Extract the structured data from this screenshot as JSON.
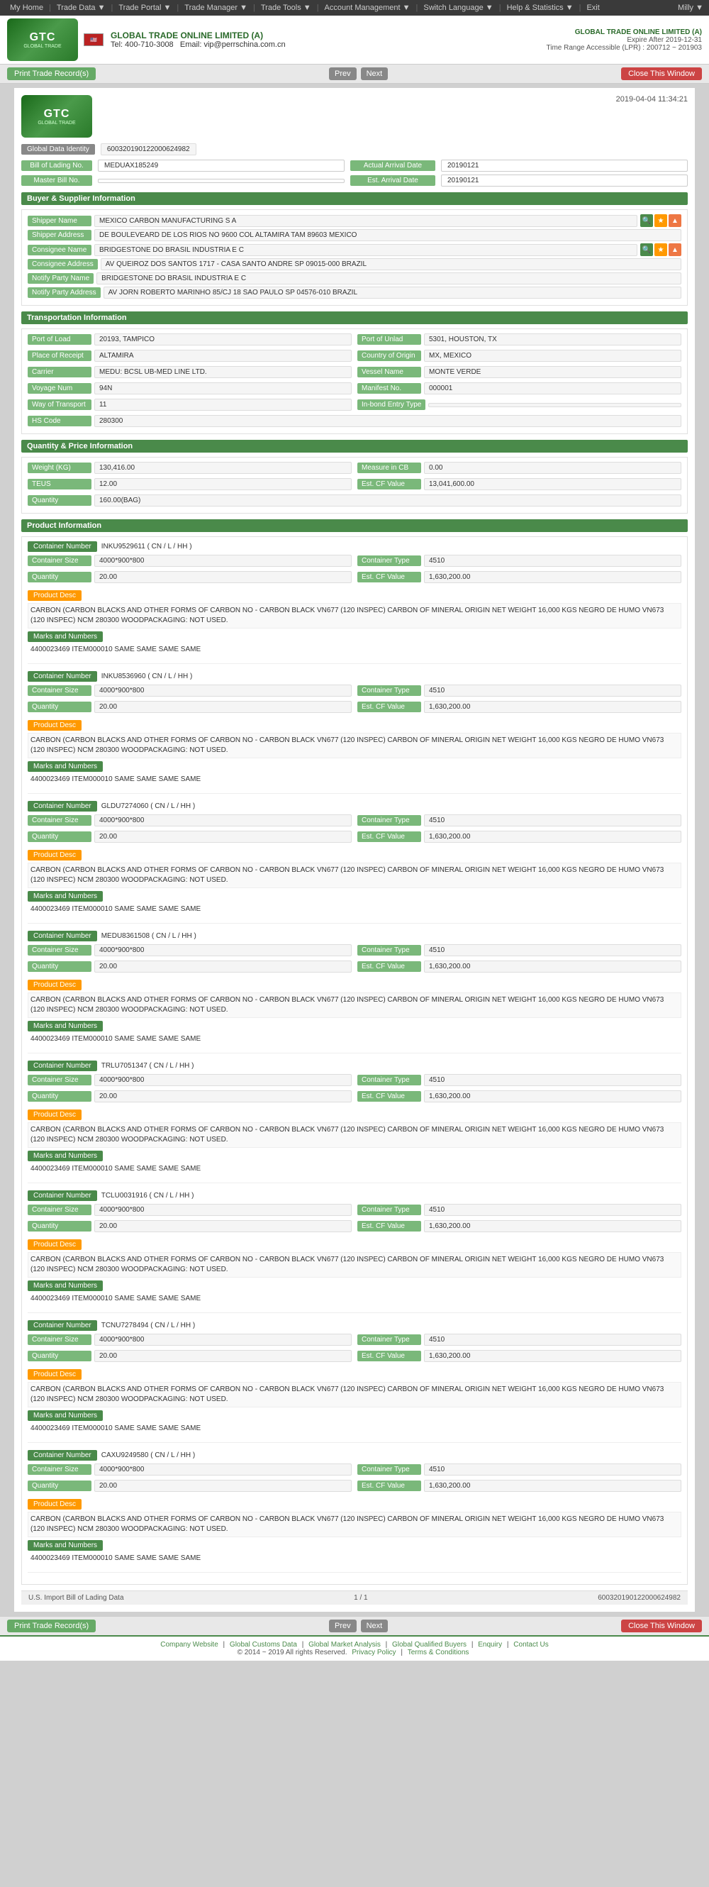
{
  "nav": {
    "items": [
      {
        "label": "My Home",
        "id": "my-home"
      },
      {
        "label": "Trade Data ▼",
        "id": "trade-data"
      },
      {
        "label": "Trade Portal ▼",
        "id": "trade-portal"
      },
      {
        "label": "Trade Manager ▼",
        "id": "trade-manager"
      },
      {
        "label": "Trade Tools ▼",
        "id": "trade-tools"
      },
      {
        "label": "Account Management ▼",
        "id": "account-management"
      },
      {
        "label": "Switch Language ▼",
        "id": "switch-language"
      },
      {
        "label": "Help & Statistics ▼",
        "id": "help-statistics"
      },
      {
        "label": "Exit",
        "id": "exit"
      }
    ],
    "user": "Milly ▼"
  },
  "header": {
    "company_name": "GLOBAL TRADE ONLINE LIMITED (A)",
    "phone": "Tel: 400-710-3008",
    "email": "Email: vip@perrschina.com.cn",
    "gtol_title": "GLOBAL TRADE ONLINE LIMITED (A)",
    "expire": "Expire After 2019-12-31",
    "time_range": "Time Range Accessible (LPR) : 200712 ~ 201903",
    "logo_text": "GTC"
  },
  "toolbar": {
    "print_label": "Print Trade Record(s)",
    "prev_label": "Prev",
    "next_label": "Next",
    "close_label": "Close This Window"
  },
  "document": {
    "title": "U.S. Import Bill of Lading Data",
    "date": "2019-04-04 11:34:21",
    "global_data_identity_label": "Global Data Identity",
    "global_data_identity_value": "600320190122000624982",
    "bill_of_lading_no_label": "Bill of Lading No.",
    "bill_of_lading_no_value": "MEDUAX185249",
    "master_bill_label": "Master Bill No.",
    "actual_arrival_date_label": "Actual Arrival Date",
    "actual_arrival_date_value": "20190121",
    "est_arrival_date_label": "Est. Arrival Date",
    "est_arrival_date_value": "20190121"
  },
  "buyer_supplier": {
    "section_title": "Buyer & Supplier Information",
    "shipper_name_label": "Shipper Name",
    "shipper_name_value": "MEXICO CARBON MANUFACTURING S A",
    "shipper_address_label": "Shipper Address",
    "shipper_address_value": "DE BOULEVEARD DE LOS RIOS NO 9600 COL ALTAMIRA TAM 89603 MEXICO",
    "consignee_name_label": "Consignee Name",
    "consignee_name_value": "BRIDGESTONE DO BRASIL INDUSTRIA E C",
    "consignee_address_label": "Consignee Address",
    "consignee_address_value": "AV QUEIROZ DOS SANTOS 1717 - CASA SANTO ANDRE SP 09015-000 BRAZIL",
    "notify_party_name_label": "Notify Party Name",
    "notify_party_name_value": "BRIDGESTONE DO BRASIL INDUSTRIA E C",
    "notify_party_address_label": "Notify Party Address",
    "notify_party_address_value": "AV JORN ROBERTO MARINHO 85/CJ 18 SAO PAULO SP 04576-010 BRAZIL"
  },
  "transportation": {
    "section_title": "Transportation Information",
    "port_of_load_label": "Port of Load",
    "port_of_load_value": "20193, TAMPICO",
    "port_of_unlad_label": "Port of Unlad",
    "port_of_unlad_value": "5301, HOUSTON, TX",
    "place_of_receipt_label": "Place of Receipt",
    "place_of_receipt_value": "ALTAMIRA",
    "country_of_origin_label": "Country of Origin",
    "country_of_origin_value": "MX, MEXICO",
    "carrier_label": "Carrier",
    "carrier_value": "MEDU: BCSL UB-MED LINE LTD.",
    "vessel_name_label": "Vessel Name",
    "vessel_name_value": "MONTE VERDE",
    "voyage_num_label": "Voyage Num",
    "voyage_num_value": "94N",
    "manifest_no_label": "Manifest No.",
    "manifest_no_value": "000001",
    "way_of_transport_label": "Way of Transport",
    "way_of_transport_value": "11",
    "in_bond_entry_type_label": "In-bond Entry Type",
    "in_bond_entry_type_value": "",
    "hs_code_label": "HS Code",
    "hs_code_value": "280300"
  },
  "quantity_price": {
    "section_title": "Quantity & Price Information",
    "weight_label": "Weight (KG)",
    "weight_value": "130,416.00",
    "measure_in_cb_label": "Measure in CB",
    "measure_in_cb_value": "0.00",
    "teus_label": "TEUS",
    "teus_value": "12.00",
    "est_cf_value_label": "Est. CF Value",
    "est_cf_value_value": "13,041,600.00",
    "quantity_label": "Quantity",
    "quantity_value": "160.00(BAG)"
  },
  "product_info": {
    "section_title": "Product Information",
    "containers": [
      {
        "id": "c1",
        "number_label": "Container Number",
        "number_value": "INKU9529611 ( CN / L / HH )",
        "size_label": "Container Size",
        "size_value": "4000*900*800",
        "type_label": "Container Type",
        "type_value": "4510",
        "quantity_label": "Quantity",
        "quantity_value": "20.00",
        "est_cf_label": "Est. CF Value",
        "est_cf_value": "1,630,200.00",
        "product_desc_label": "Product Desc",
        "product_desc": "CARBON (CARBON BLACKS AND OTHER FORMS OF CARBON NO - CARBON BLACK VN677 (120 INSPEC) CARBON OF MINERAL ORIGIN NET WEIGHT 16,000 KGS NEGRO DE HUMO VN673 (120 INSPEC) NCM 280300 WOODPACKAGING: NOT USED.",
        "marks_label": "Marks and Numbers",
        "marks_value": "4400023469 ITEM000010 SAME SAME SAME SAME"
      },
      {
        "id": "c2",
        "number_label": "Container Number",
        "number_value": "INKU8536960 ( CN / L / HH )",
        "size_label": "Container Size",
        "size_value": "4000*900*800",
        "type_label": "Container Type",
        "type_value": "4510",
        "quantity_label": "Quantity",
        "quantity_value": "20.00",
        "est_cf_label": "Est. CF Value",
        "est_cf_value": "1,630,200.00",
        "product_desc_label": "Product Desc",
        "product_desc": "CARBON (CARBON BLACKS AND OTHER FORMS OF CARBON NO - CARBON BLACK VN677 (120 INSPEC) CARBON OF MINERAL ORIGIN NET WEIGHT 16,000 KGS NEGRO DE HUMO VN673 (120 INSPEC) NCM 280300 WOODPACKAGING: NOT USED.",
        "marks_label": "Marks and Numbers",
        "marks_value": "4400023469 ITEM000010 SAME SAME SAME SAME"
      },
      {
        "id": "c3",
        "number_label": "Container Number",
        "number_value": "GLDU7274060 ( CN / L / HH )",
        "size_label": "Container Size",
        "size_value": "4000*900*800",
        "type_label": "Container Type",
        "type_value": "4510",
        "quantity_label": "Quantity",
        "quantity_value": "20.00",
        "est_cf_label": "Est. CF Value",
        "est_cf_value": "1,630,200.00",
        "product_desc_label": "Product Desc",
        "product_desc": "CARBON (CARBON BLACKS AND OTHER FORMS OF CARBON NO - CARBON BLACK VN677 (120 INSPEC) CARBON OF MINERAL ORIGIN NET WEIGHT 16,000 KGS NEGRO DE HUMO VN673 (120 INSPEC) NCM 280300 WOODPACKAGING: NOT USED.",
        "marks_label": "Marks and Numbers",
        "marks_value": "4400023469 ITEM000010 SAME SAME SAME SAME"
      },
      {
        "id": "c4",
        "number_label": "Container Number",
        "number_value": "MEDU8361508 ( CN / L / HH )",
        "size_label": "Container Size",
        "size_value": "4000*900*800",
        "type_label": "Container Type",
        "type_value": "4510",
        "quantity_label": "Quantity",
        "quantity_value": "20.00",
        "est_cf_label": "Est. CF Value",
        "est_cf_value": "1,630,200.00",
        "product_desc_label": "Product Desc",
        "product_desc": "CARBON (CARBON BLACKS AND OTHER FORMS OF CARBON NO - CARBON BLACK VN677 (120 INSPEC) CARBON OF MINERAL ORIGIN NET WEIGHT 16,000 KGS NEGRO DE HUMO VN673 (120 INSPEC) NCM 280300 WOODPACKAGING: NOT USED.",
        "marks_label": "Marks and Numbers",
        "marks_value": "4400023469 ITEM000010 SAME SAME SAME SAME"
      },
      {
        "id": "c5",
        "number_label": "Container Number",
        "number_value": "TRLU7051347 ( CN / L / HH )",
        "size_label": "Container Size",
        "size_value": "4000*900*800",
        "type_label": "Container Type",
        "type_value": "4510",
        "quantity_label": "Quantity",
        "quantity_value": "20.00",
        "est_cf_label": "Est. CF Value",
        "est_cf_value": "1,630,200.00",
        "product_desc_label": "Product Desc",
        "product_desc": "CARBON (CARBON BLACKS AND OTHER FORMS OF CARBON NO - CARBON BLACK VN677 (120 INSPEC) CARBON OF MINERAL ORIGIN NET WEIGHT 16,000 KGS NEGRO DE HUMO VN673 (120 INSPEC) NCM 280300 WOODPACKAGING: NOT USED.",
        "marks_label": "Marks and Numbers",
        "marks_value": "4400023469 ITEM000010 SAME SAME SAME SAME"
      },
      {
        "id": "c6",
        "number_label": "Container Number",
        "number_value": "TCLU0031916 ( CN / L / HH )",
        "size_label": "Container Size",
        "size_value": "4000*900*800",
        "type_label": "Container Type",
        "type_value": "4510",
        "quantity_label": "Quantity",
        "quantity_value": "20.00",
        "est_cf_label": "Est. CF Value",
        "est_cf_value": "1,630,200.00",
        "product_desc_label": "Product Desc",
        "product_desc": "CARBON (CARBON BLACKS AND OTHER FORMS OF CARBON NO - CARBON BLACK VN677 (120 INSPEC) CARBON OF MINERAL ORIGIN NET WEIGHT 16,000 KGS NEGRO DE HUMO VN673 (120 INSPEC) NCM 280300 WOODPACKAGING: NOT USED.",
        "marks_label": "Marks and Numbers",
        "marks_value": "4400023469 ITEM000010 SAME SAME SAME SAME"
      },
      {
        "id": "c7",
        "number_label": "Container Number",
        "number_value": "TCNU7278494 ( CN / L / HH )",
        "size_label": "Container Size",
        "size_value": "4000*900*800",
        "type_label": "Container Type",
        "type_value": "4510",
        "quantity_label": "Quantity",
        "quantity_value": "20.00",
        "est_cf_label": "Est. CF Value",
        "est_cf_value": "1,630,200.00",
        "product_desc_label": "Product Desc",
        "product_desc": "CARBON (CARBON BLACKS AND OTHER FORMS OF CARBON NO - CARBON BLACK VN677 (120 INSPEC) CARBON OF MINERAL ORIGIN NET WEIGHT 16,000 KGS NEGRO DE HUMO VN673 (120 INSPEC) NCM 280300 WOODPACKAGING: NOT USED.",
        "marks_label": "Marks and Numbers",
        "marks_value": "4400023469 ITEM000010 SAME SAME SAME SAME"
      },
      {
        "id": "c8",
        "number_label": "Container Number",
        "number_value": "CAXU9249580 ( CN / L / HH )",
        "size_label": "Container Size",
        "size_value": "4000*900*800",
        "type_label": "Container Type",
        "type_value": "4510",
        "quantity_label": "Quantity",
        "quantity_value": "20.00",
        "est_cf_label": "Est. CF Value",
        "est_cf_value": "1,630,200.00",
        "product_desc_label": "Product Desc",
        "product_desc": "CARBON (CARBON BLACKS AND OTHER FORMS OF CARBON NO - CARBON BLACK VN677 (120 INSPEC) CARBON OF MINERAL ORIGIN NET WEIGHT 16,000 KGS NEGRO DE HUMO VN673 (120 INSPEC) NCM 280300 WOODPACKAGING: NOT USED.",
        "marks_label": "Marks and Numbers",
        "marks_value": "4400023469 ITEM000010 SAME SAME SAME SAME"
      }
    ]
  },
  "bottom": {
    "doc_label": "U.S. Import Bill of Lading Data",
    "page_info": "1 / 1",
    "identity_value": "600320190122000624982",
    "print_label": "Print Trade Record(s)",
    "prev_label": "Prev",
    "next_label": "Next",
    "close_label": "Close This Window"
  },
  "footer": {
    "links": [
      "Company Website",
      "Global Customs Data",
      "Global Market Analysis",
      "Global Qualified Buyers",
      "Enquiry",
      "Contact Us"
    ],
    "copyright": "© 2014 ~ 2019 All rights Reserved.",
    "policy_links": [
      "Privacy Policy",
      "Terms & Conditions"
    ]
  }
}
